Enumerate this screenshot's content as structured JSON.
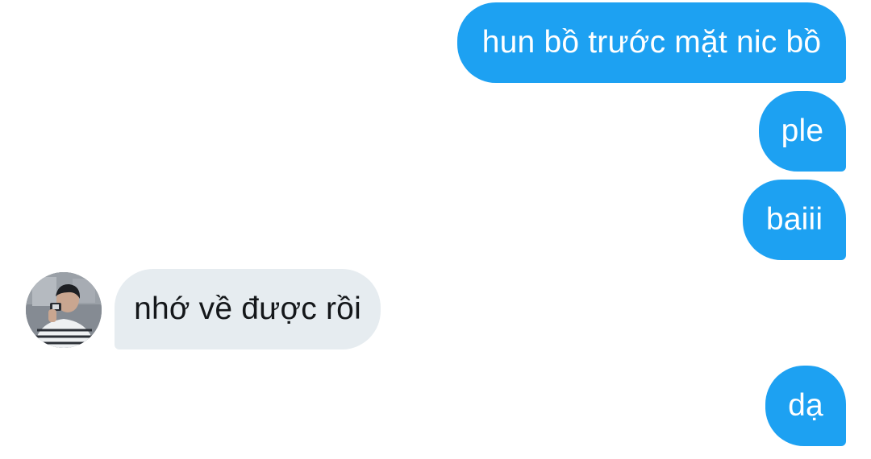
{
  "conversation": {
    "messages": [
      {
        "direction": "sent",
        "text": "hun bồ trước mặt nic bồ"
      },
      {
        "direction": "sent",
        "text": "ple"
      },
      {
        "direction": "sent",
        "text": "baiii"
      },
      {
        "direction": "received",
        "text": "nhớ về được rồi"
      },
      {
        "direction": "sent",
        "text": "dạ"
      }
    ]
  },
  "colors": {
    "sent_bubble": "#1da1f2",
    "received_bubble": "#e6ecf0",
    "sent_text": "#ffffff",
    "received_text": "#14171a"
  },
  "icons": {
    "sender_avatar": "avatar"
  }
}
